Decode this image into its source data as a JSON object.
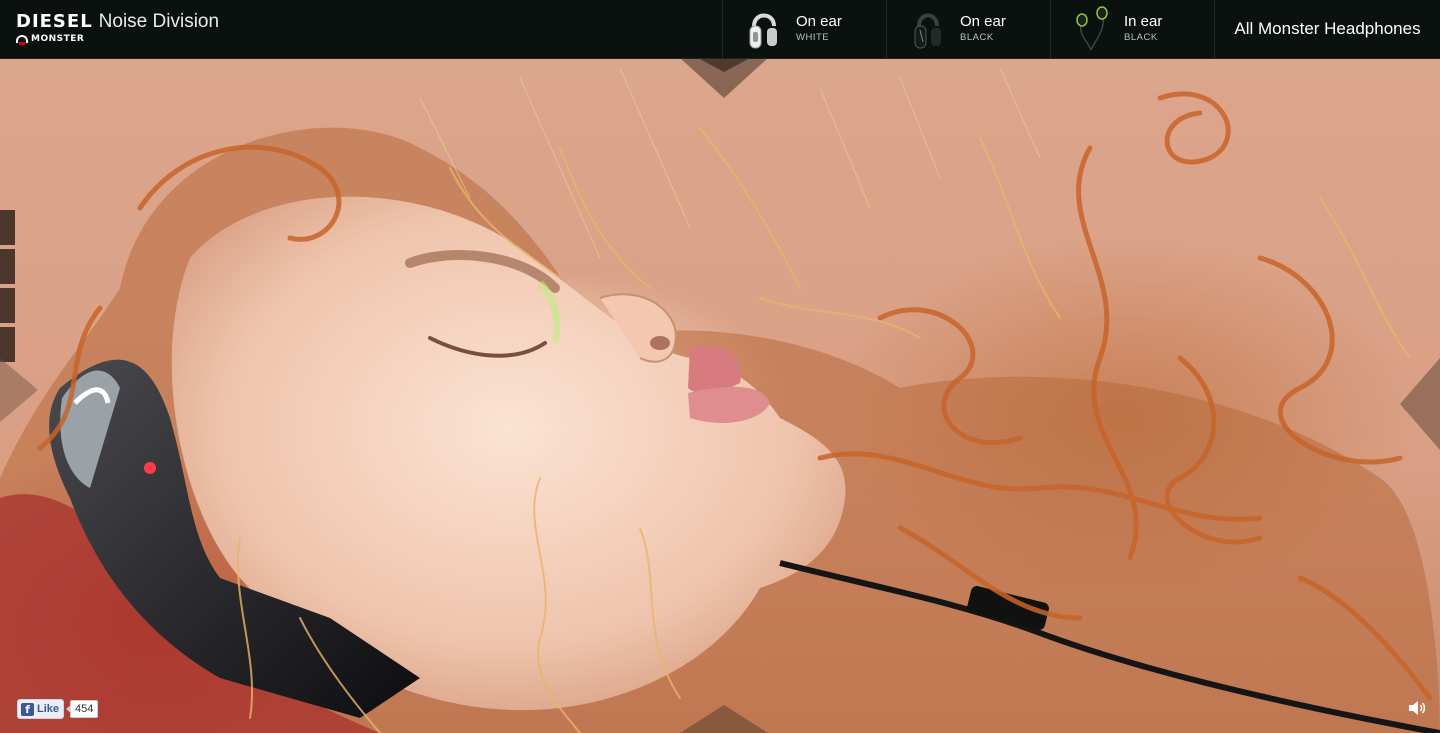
{
  "brand": {
    "name": "DIESEL",
    "division": "Noise Division",
    "partner": "MONSTER"
  },
  "nav": {
    "items": [
      {
        "label": "On ear",
        "sub": "WHITE",
        "icon": "white-headphones-icon"
      },
      {
        "label": "On ear",
        "sub": "BLACK",
        "icon": "black-headphones-icon"
      },
      {
        "label": "In ear",
        "sub": "BLACK",
        "icon": "in-ear-headphones-icon"
      }
    ],
    "all_label": "All Monster Headphones"
  },
  "social": {
    "like_label": "Like",
    "like_count": "454",
    "icon": "facebook-icon"
  },
  "controls": {
    "volume_icon": "speaker-icon",
    "slides": 4
  },
  "colors": {
    "topbar": "#0b110e",
    "facebook": "#3b5998",
    "accent_hair": "#c8642a"
  }
}
